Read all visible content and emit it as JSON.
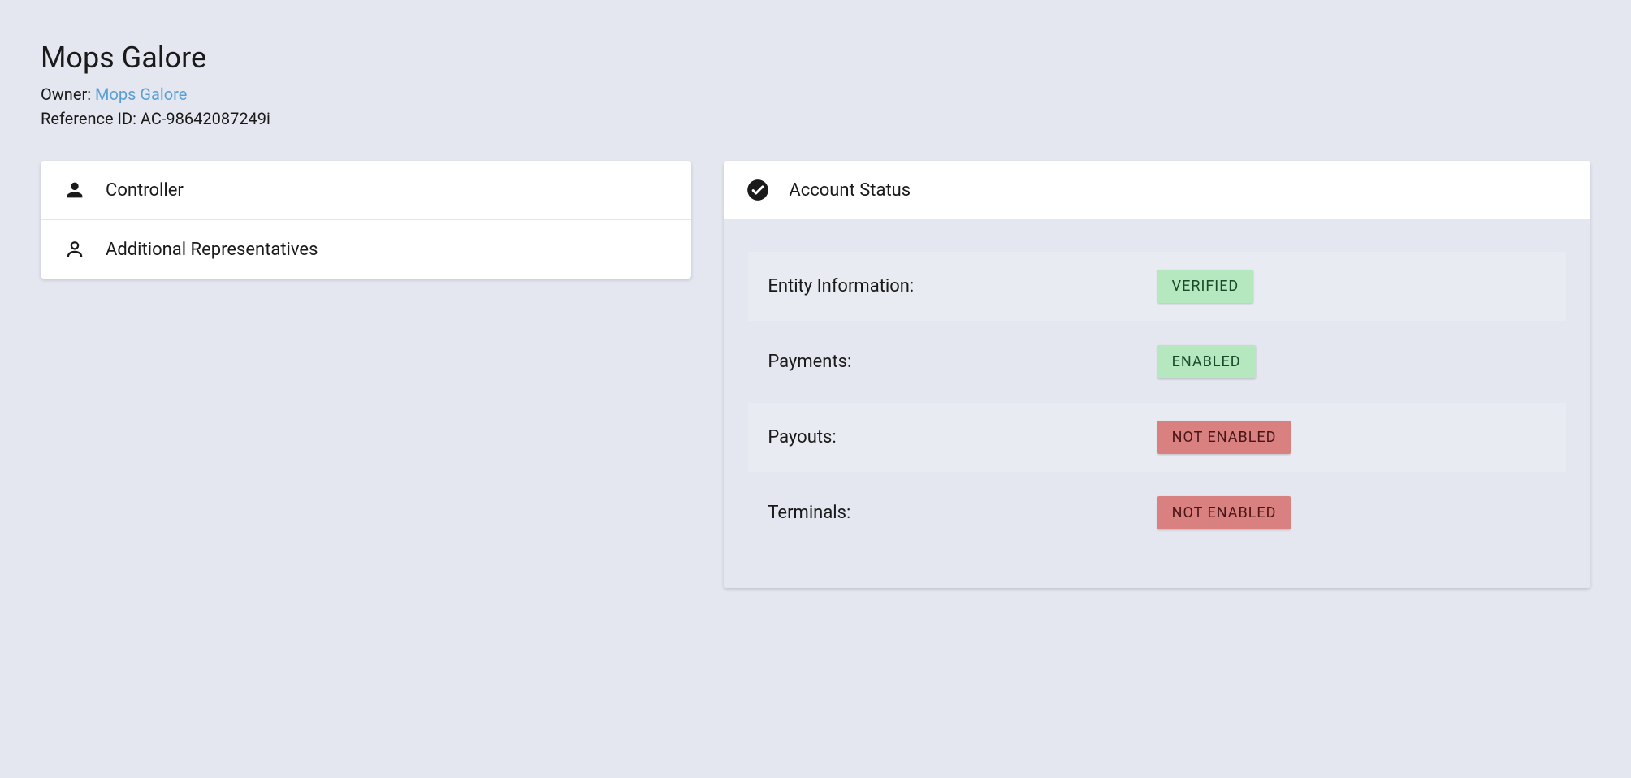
{
  "header": {
    "title": "Mops Galore",
    "owner_label": "Owner: ",
    "owner_link": "Mops Galore",
    "ref_label": "Reference ID: ",
    "ref_value": "AC-98642087249i"
  },
  "left_panel": {
    "items": [
      {
        "label": "Controller",
        "icon": "person-filled-icon"
      },
      {
        "label": "Additional Representatives",
        "icon": "person-outline-icon"
      }
    ]
  },
  "right_panel": {
    "title": "Account Status",
    "icon": "check-circle-icon",
    "status": [
      {
        "label": "Entity Information:",
        "badge": "VERIFIED",
        "style": "green"
      },
      {
        "label": "Payments:",
        "badge": "ENABLED",
        "style": "green"
      },
      {
        "label": "Payouts:",
        "badge": "NOT ENABLED",
        "style": "red"
      },
      {
        "label": "Terminals:",
        "badge": "NOT ENABLED",
        "style": "red"
      }
    ]
  }
}
